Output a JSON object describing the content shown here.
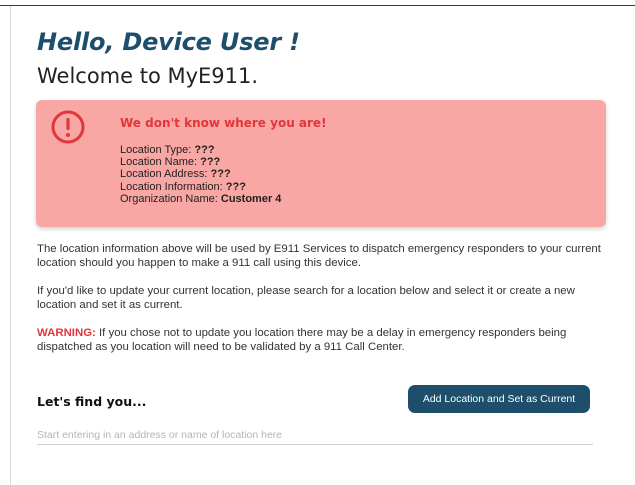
{
  "header": {
    "greeting": "Hello, Device User !",
    "welcome": "Welcome to MyE911."
  },
  "alert": {
    "icon": "exclamation-circle-icon",
    "title": "We don't know where you are!",
    "lines": [
      {
        "label": "Location Type: ",
        "value": "???"
      },
      {
        "label": "Location Name: ",
        "value": "???"
      },
      {
        "label": "Location Address: ",
        "value": "???"
      },
      {
        "label": "Location Information: ",
        "value": "???"
      },
      {
        "label": "Organization Name: ",
        "value": "Customer 4"
      }
    ],
    "colors": {
      "background": "#f9a7a5",
      "accent": "#e0373a"
    }
  },
  "info": {
    "paragraph1": "The location information above will be used by E911 Services to dispatch emergency responders to your current location should you happen to make a 911 call using this device.",
    "paragraph2": "If you'd like to update your current location, please search for a location below and select it or create a new location and set it as current.",
    "warning_label": "WARNING:",
    "warning_text": " If you chose not to update you location there may be a delay in emergency responders being dispatched as you location will need to be validated by a 911 Call Center."
  },
  "find": {
    "title": "Let's find you...",
    "add_button_label": "Add Location and Set as Current",
    "search_placeholder": "Start entering in an address or name of location here",
    "search_value": ""
  },
  "colors": {
    "brand": "#1d4e6b",
    "warning": "#e0373a"
  }
}
